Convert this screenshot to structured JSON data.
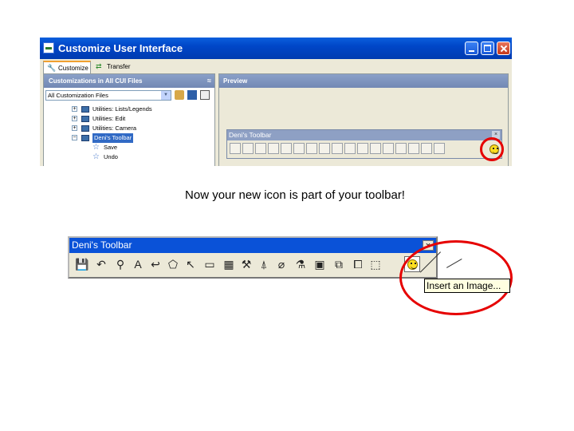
{
  "window": {
    "title": "Customize User Interface"
  },
  "tabs": [
    {
      "label": "Customize",
      "icon": "wrench-icon"
    },
    {
      "label": "Transfer",
      "icon": "transfer-arrows-icon"
    }
  ],
  "left_panel": {
    "header": "Customizations in All CUI Files",
    "files_select": "All Customization Files",
    "tree": [
      {
        "label": "Utilities: Lists/Legends",
        "type": "node"
      },
      {
        "label": "Utilities: Edit",
        "type": "node"
      },
      {
        "label": "Utilities: Camera",
        "type": "node"
      },
      {
        "label": "Deni's Toolbar",
        "type": "node",
        "selected": true
      },
      {
        "label": "Save",
        "type": "leaf"
      },
      {
        "label": "Undo",
        "type": "leaf"
      }
    ]
  },
  "preview": {
    "header": "Preview",
    "toolbar_title": "Deni's Toolbar",
    "close_glyph": "×"
  },
  "caption": "Now your new icon is part of your toolbar!",
  "toolbar": {
    "title": "Deni's Toolbar",
    "close_glyph": "×",
    "tools": [
      "save-icon",
      "undo-icon",
      "match-properties-icon",
      "text-icon",
      "multileader-icon",
      "revision-cloud-icon",
      "dimension-icon",
      "measure-icon",
      "hatch-icon",
      "image-icon",
      "region-icon",
      "erase-icon",
      "attribute-icon",
      "box-icon",
      "layer-icon",
      "copy-icon",
      "insert-icon",
      "smiley-icon"
    ],
    "tooltip": "Insert an Image..."
  },
  "colors": {
    "xp_title_blue": "#0a52d8",
    "highlight_red": "#e60000",
    "tooltip_bg": "#ffffe1"
  }
}
